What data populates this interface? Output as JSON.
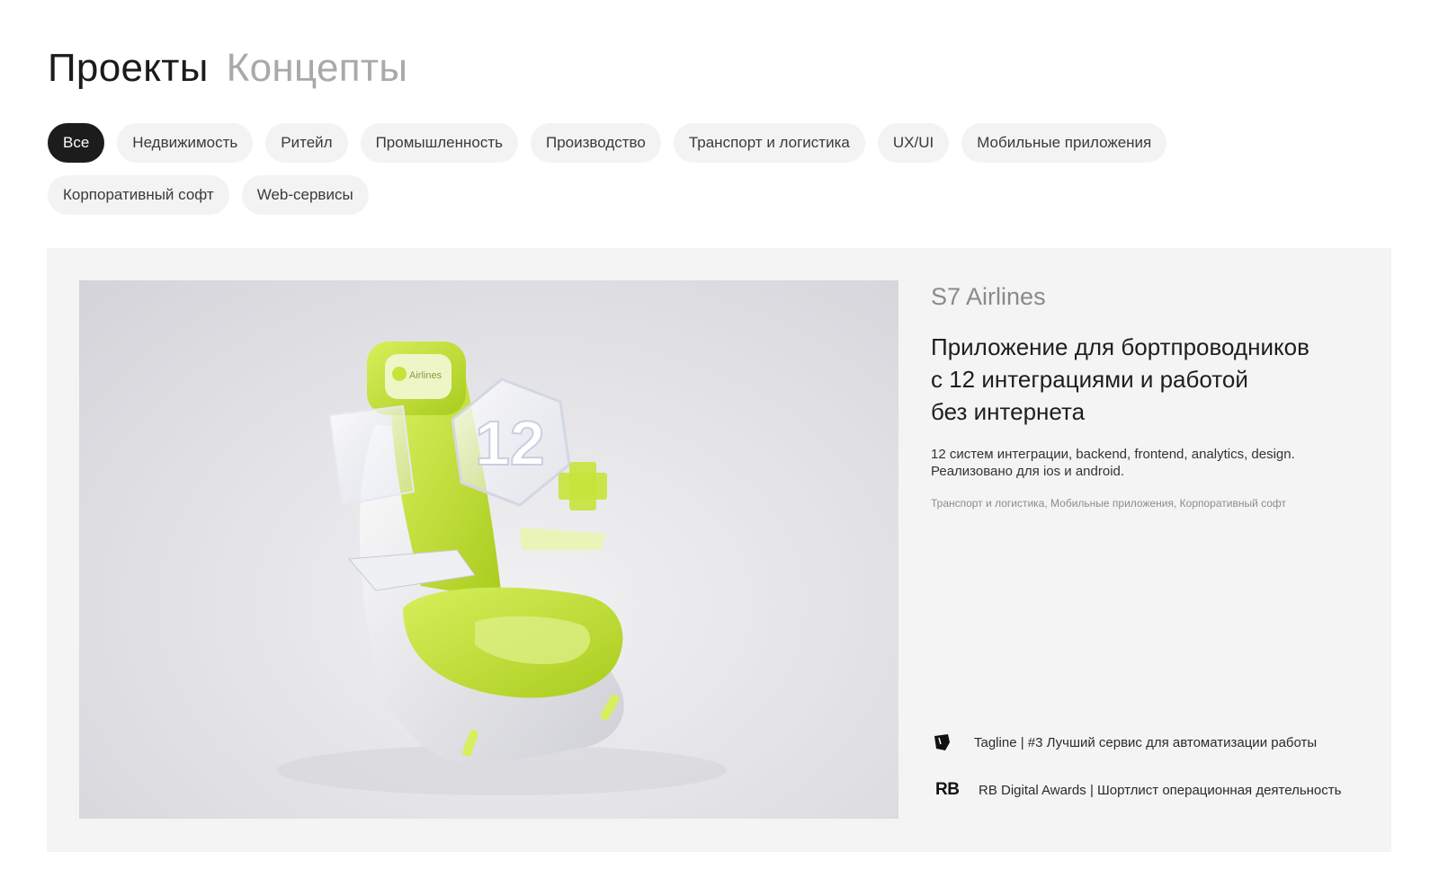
{
  "heading": {
    "projects": "Проекты",
    "concepts": "Концепты"
  },
  "filters": [
    {
      "label": "Все",
      "selected": true
    },
    {
      "label": "Недвижимость",
      "selected": false
    },
    {
      "label": "Ритейл",
      "selected": false
    },
    {
      "label": "Промышленность",
      "selected": false
    },
    {
      "label": "Производство",
      "selected": false
    },
    {
      "label": "Транспорт и логистика",
      "selected": false
    },
    {
      "label": "UX/UI",
      "selected": false
    },
    {
      "label": "Мобильные приложения",
      "selected": false
    },
    {
      "label": "Корпоративный софт",
      "selected": false
    },
    {
      "label": "Web-сервисы",
      "selected": false
    }
  ],
  "project": {
    "client": "S7 Airlines",
    "title_lines": [
      "Приложение для бортпроводников",
      "с 12 интеграциями и работой",
      "без интернета"
    ],
    "description_lines": [
      "12 систем интеграции, backend, frontend, analytics, design.",
      "Реализовано для ios и android."
    ],
    "tags": "Транспорт и логистика, Мобильные приложения, Корпоративный софт",
    "image_logo_text": "Airlines",
    "image_badge_text": "12",
    "awards": [
      {
        "icon": "tagline-icon",
        "text": "Tagline | #3 Лучший сервис для автоматизации работы"
      },
      {
        "icon": "rb-icon",
        "icon_text": "RB",
        "text": "RB Digital Awards | Шортлист операционная деятельность"
      }
    ]
  },
  "colors": {
    "accent_green": "#c5e43a",
    "chip_bg": "#f3f3f3",
    "chip_selected_bg": "#1c1c1c",
    "card_bg": "#f4f4f4"
  }
}
